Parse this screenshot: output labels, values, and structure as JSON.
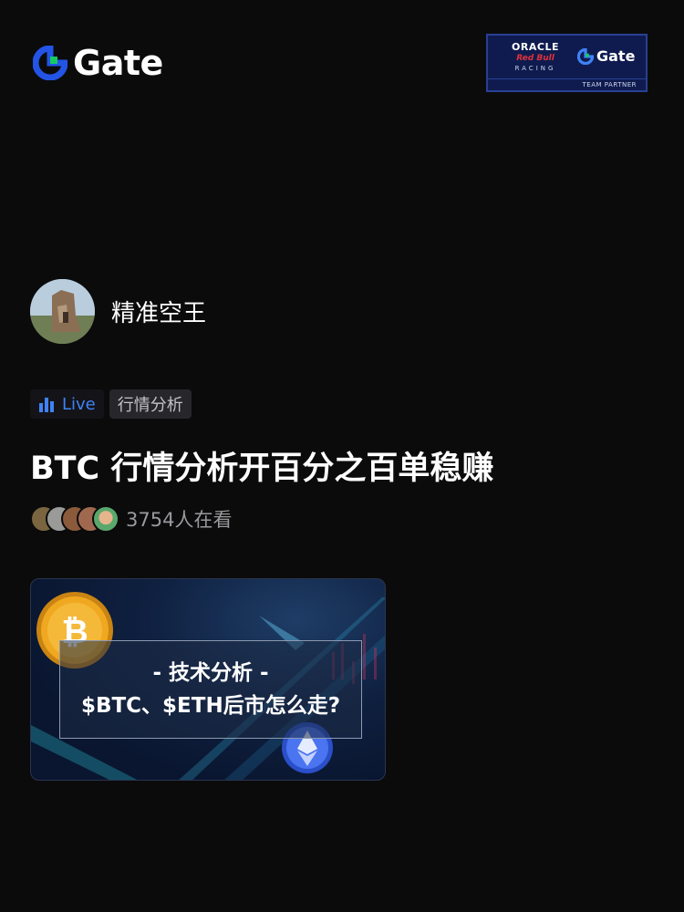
{
  "header": {
    "logo_text": "Gate",
    "brand_color": "#2354e6",
    "accent_green": "#17c964"
  },
  "partner": {
    "oracle": "ORACLE",
    "redbull": "Red Bull",
    "racing": "RACING",
    "gate": "Gate",
    "footer": "TEAM PARTNER"
  },
  "user": {
    "name": "精准空王"
  },
  "tags": {
    "live_label": "Live",
    "category": "行情分析",
    "live_color": "#3f82f5"
  },
  "stream": {
    "title": "BTC 行情分析开百分之百单稳赚",
    "viewers": "3754人在看"
  },
  "thumbnail": {
    "line1": "- 技术分析 -",
    "line2": "$BTC、$ETH后市怎么走?"
  }
}
